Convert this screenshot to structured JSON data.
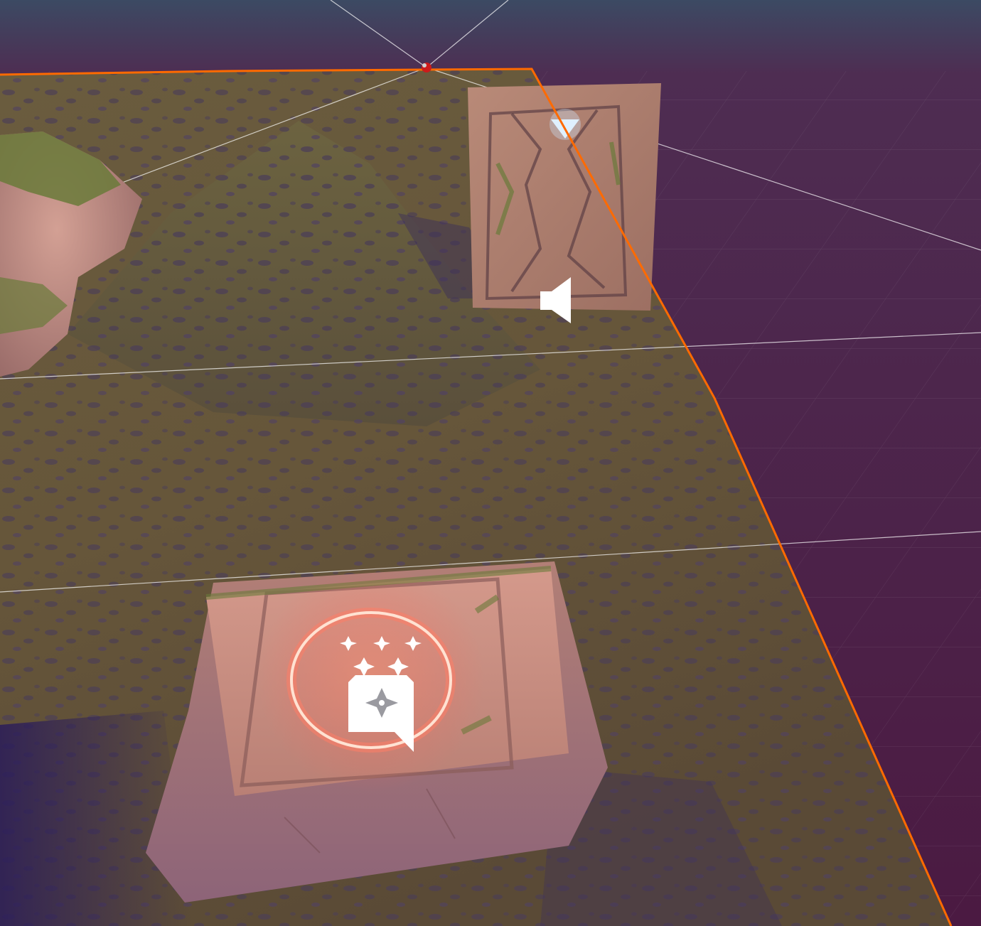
{
  "editor": {
    "view": "scene-view",
    "background_color": "#4e1f45",
    "selection_outline_color": "#ff6a00",
    "grid_color": "#ffffff"
  },
  "scene": {
    "objects": [
      {
        "name": "terrain",
        "kind": "terrain-mesh"
      },
      {
        "name": "rock-cliff",
        "kind": "mesh"
      },
      {
        "name": "stone-door",
        "kind": "mesh"
      },
      {
        "name": "stone-pedestal",
        "kind": "mesh"
      },
      {
        "name": "glowing-ring",
        "kind": "particle-effect",
        "color": "#ff8a6a"
      }
    ]
  },
  "gizmos": {
    "audio_source": {
      "icon": "speaker-icon"
    },
    "particle_system": {
      "icon": "particle-system-icon"
    },
    "light": {
      "icon": "directional-light-icon"
    }
  }
}
